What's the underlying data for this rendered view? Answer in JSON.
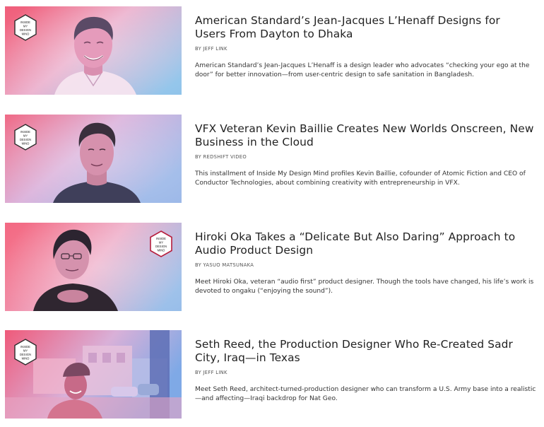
{
  "badge": {
    "lines": [
      "INSIDE",
      "MY",
      "DESIGN",
      "MIND"
    ]
  },
  "colors": {
    "gradient_left": "#f25c7a",
    "gradient_mid": "#e9a6c8",
    "gradient_right": "#8fb7e8",
    "badge_border": "#b61d3c"
  },
  "articles": [
    {
      "title": "American Standard’s Jean-Jacques L’Henaff Designs for Users From Dayton to Dhaka",
      "byline": "BY JEFF LINK",
      "summary": "American Standard’s Jean-Jacques L’Henaff is a design leader who advocates “checking your ego at the door” for better innovation—from user-centric design to safe sanitation in Bangladesh."
    },
    {
      "title": "VFX Veteran Kevin Baillie Creates New Worlds Onscreen, New Business in the Cloud",
      "byline": "BY REDSHIFT VIDEO",
      "summary": "This installment of Inside My Design Mind profiles Kevin Baillie, cofounder of Atomic Fiction and CEO of Conductor Technologies, about combining creativity with entrepreneurship in VFX."
    },
    {
      "title": "Hiroki Oka Takes a “Delicate But Also Daring” Approach to Audio Product Design",
      "byline": "BY YASUO MATSUNAKA",
      "summary": "Meet Hiroki Oka, veteran “audio first” product designer. Though the tools have changed, his life’s work is devoted to ongaku (“enjoying the sound”)."
    },
    {
      "title": "Seth Reed, the Production Designer Who Re-Created Sadr City, Iraq—in Texas",
      "byline": "BY JEFF LINK",
      "summary": "Meet Seth Reed, architect-turned-production designer who can transform a U.S. Army base into a realistic—and affecting—Iraqi backdrop for Nat Geo."
    }
  ]
}
